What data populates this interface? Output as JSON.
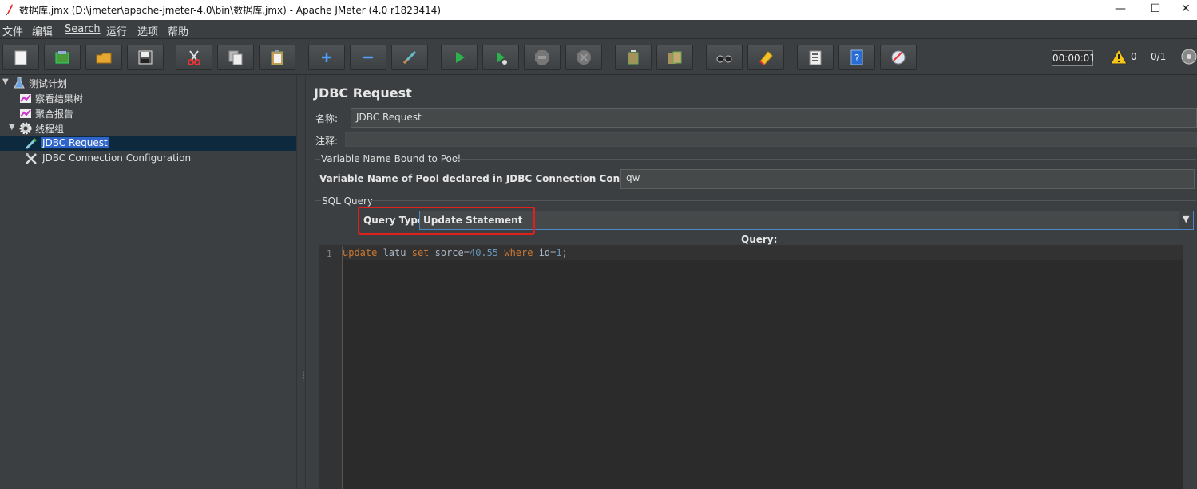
{
  "window": {
    "title": "数据库.jmx (D:\\jmeter\\apache-jmeter-4.0\\bin\\数据库.jmx) - Apache JMeter (4.0 r1823414)",
    "minimize": "—",
    "maximize": "☐",
    "close": "✕"
  },
  "menu": {
    "items": [
      "文件",
      "编辑",
      "Search",
      "运行",
      "选项",
      "帮助"
    ]
  },
  "toolbar": {
    "icons": [
      "new-icon",
      "templates-icon",
      "open-icon",
      "save-icon",
      "cut-icon",
      "copy-icon",
      "paste-icon",
      "expand-icon",
      "collapse-icon",
      "toggle-icon",
      "start-icon",
      "start-no-pauses-icon",
      "stop-icon",
      "shutdown-icon",
      "clear-icon",
      "clear-all-icon",
      "search-icon",
      "reset-search-icon",
      "function-helper-icon",
      "help-icon",
      "remote-icon"
    ],
    "timer": "00:00:01",
    "warnings": "0",
    "threads": "0/1"
  },
  "tree": {
    "items": [
      {
        "label": "测试计划",
        "icon": "test-plan-icon"
      },
      {
        "label": "察看结果树",
        "icon": "listener-icon"
      },
      {
        "label": "聚合报告",
        "icon": "listener-icon"
      },
      {
        "label": "线程组",
        "icon": "thread-group-icon"
      },
      {
        "label": "JDBC Request",
        "icon": "sampler-icon"
      },
      {
        "label": "JDBC Connection Configuration",
        "icon": "config-icon"
      }
    ]
  },
  "panel": {
    "title": "JDBC Request",
    "name_label": "名称:",
    "name_value": "JDBC Request",
    "comment_label": "注释:",
    "comment_value": "",
    "pool_group_title": "Variable Name Bound to Pool",
    "pool_label": "Variable Name of Pool declared in JDBC Connection Configuration:",
    "pool_value": "qw",
    "sql_group_title": "SQL Query",
    "query_type_label": "Query Type:",
    "query_type_value": "Update Statement",
    "query_label": "Query:",
    "line_number": "1",
    "code": {
      "t1": "update",
      "t2": " latu ",
      "t3": "set",
      "t4": " sorce=",
      "t5": "40.55",
      "t6": " ",
      "t7": "where",
      "t8": " id=",
      "t9": "1",
      "t10": ";"
    }
  }
}
